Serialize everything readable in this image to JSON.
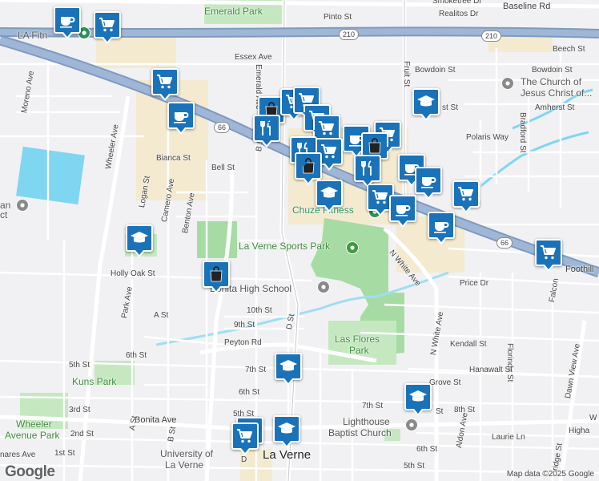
{
  "map": {
    "attribution": "Map data ©2025 Google",
    "logo": "Google",
    "colors": {
      "background": "#f1f1f3",
      "park": "#a6dca3",
      "parkLight": "#c5e8c0",
      "commercial": "#f4ead0",
      "water": "#7fd6f0",
      "freeway": "#8ea8c8",
      "majorRoad": "#ffffff",
      "pin": "#1a73b8"
    }
  },
  "shields": [
    {
      "id": "210-a",
      "label": "210"
    },
    {
      "id": "210-b",
      "label": "210"
    },
    {
      "id": "66-a",
      "label": "66"
    },
    {
      "id": "66-b",
      "label": "66"
    }
  ],
  "labels": {
    "emerald_park": "Emerald Park",
    "pinto_st": "Pinto St",
    "realitos_dr": "Realitos Dr",
    "smoketree_dr": "Smoketree Dr",
    "baseline_rd": "Baseline Rd",
    "la_fitness": "LA Fitn",
    "beech_st": "Beech St",
    "essex_ave": "Essex Ave",
    "bowdoin_st_1": "Bowdoin St",
    "bowdoin_st_2": "Bowdoin St",
    "emerald_ave": "Emerald Ave",
    "fruit_st": "Fruit St",
    "moreno_ave": "Moreno Ave",
    "church_jesus_1": "The Church of",
    "church_jesus_2": "Jesus Christ of...",
    "amherst_st_1": "Amherst St",
    "amherst_st_2": "st St",
    "wheeler_ave": "Wheeler Ave",
    "polaris_way": "Polaris Way",
    "bradford_st": "Bradford St",
    "bianca_st": "Bianca St",
    "bell_st": "Bell St",
    "b_st": "B St",
    "logan_st": "Logan St",
    "camero_ave": "Camero Ave",
    "benton_ave": "Benton Ave",
    "chuze_fitness": "Chuze Fitness",
    "la_verne_sports_park": "La Verne Sports Park",
    "park_ave": "Park Ave",
    "holly_oak_st": "Holly Oak St",
    "bonita_high_school": "Bonita High School",
    "n_white_ave_1": "N White Ave",
    "price_dr": "Price Dr",
    "foothill": "Foothill",
    "falcon": "Falcon",
    "a_st_1": "A St",
    "tenth_st": "10th St",
    "ninth_st": "9th St",
    "d_st_1": "D St",
    "peyton_rd": "Peyton Rd",
    "las_flores_park_1": "Las Flores",
    "las_flores_park_2": "Park",
    "n_white_ave_2": "N White Ave",
    "kendall_st": "Kendall St",
    "florinda_st": "Florinda St",
    "dawn_view_ave": "Dawn View Ave",
    "sixth_st_1": "6th St",
    "hanawalt_st": "Hanawalt St",
    "fifth_st_1": "5th St",
    "kuns_park": "Kuns Park",
    "seventh_st_1": "7th St",
    "grove_st": "Grove St",
    "sixth_st_2": "6th St",
    "seventh_st_2": "7th St",
    "eighth_st": "8th St",
    "st_frag": "St",
    "third_st": "3rd St",
    "bonita_ave": "Bonita Ave",
    "fifth_st_2": "5th St",
    "lighthouse_1": "Lighthouse",
    "lighthouse_2": "Baptist Church",
    "aldon_ave": "Aldon Ave",
    "w_frag": "W",
    "wheeler_park_1": "Wheeler",
    "wheeler_park_2": "Avenue Park",
    "second_st": "2nd St",
    "a_st_2": "A St",
    "b_st_2": "B St",
    "laurie_ln": "Laurie Ln",
    "higha": "Higha",
    "sixth_st_3": "6th St",
    "university_1": "University of",
    "university_2": "La Verne",
    "d_frag": "D",
    "la_verne": "La Verne",
    "first_st": "1st St",
    "fifth_st_3": "5th St",
    "ridge_st": "ridge St",
    "ani_frag": "an",
    "ct_frag": "ct",
    "nares_ave": "nares Ave"
  },
  "markers": [
    {
      "id": "m1",
      "icon": "coffee"
    },
    {
      "id": "m2",
      "icon": "cart"
    },
    {
      "id": "m3",
      "icon": "cart"
    },
    {
      "id": "m4",
      "icon": "coffee"
    },
    {
      "id": "m5",
      "icon": "shopping-bag"
    },
    {
      "id": "m6",
      "icon": "cart"
    },
    {
      "id": "m7",
      "icon": "cart"
    },
    {
      "id": "m8",
      "icon": "restaurant"
    },
    {
      "id": "m9",
      "icon": "cart"
    },
    {
      "id": "m10",
      "icon": "cart"
    },
    {
      "id": "m11",
      "icon": "coffee"
    },
    {
      "id": "m12",
      "icon": "cart"
    },
    {
      "id": "m13",
      "icon": "restaurant"
    },
    {
      "id": "m14",
      "icon": "cart"
    },
    {
      "id": "m15",
      "icon": "shopping-bag"
    },
    {
      "id": "m16",
      "icon": "shopping-bag"
    },
    {
      "id": "m17",
      "icon": "restaurant"
    },
    {
      "id": "m18",
      "icon": "school"
    },
    {
      "id": "m19",
      "icon": "coffee"
    },
    {
      "id": "m20",
      "icon": "coffee"
    },
    {
      "id": "m21",
      "icon": "cart"
    },
    {
      "id": "m22",
      "icon": "coffee"
    },
    {
      "id": "m23",
      "icon": "school"
    },
    {
      "id": "m24",
      "icon": "cart"
    },
    {
      "id": "m25",
      "icon": "coffee"
    },
    {
      "id": "m26",
      "icon": "cart"
    },
    {
      "id": "m27",
      "icon": "school"
    },
    {
      "id": "m28",
      "icon": "shopping-bag"
    },
    {
      "id": "m29",
      "icon": "school"
    },
    {
      "id": "m30",
      "icon": "school"
    },
    {
      "id": "m31",
      "icon": "cart"
    },
    {
      "id": "m32",
      "icon": "cart"
    },
    {
      "id": "m33",
      "icon": "school"
    }
  ]
}
